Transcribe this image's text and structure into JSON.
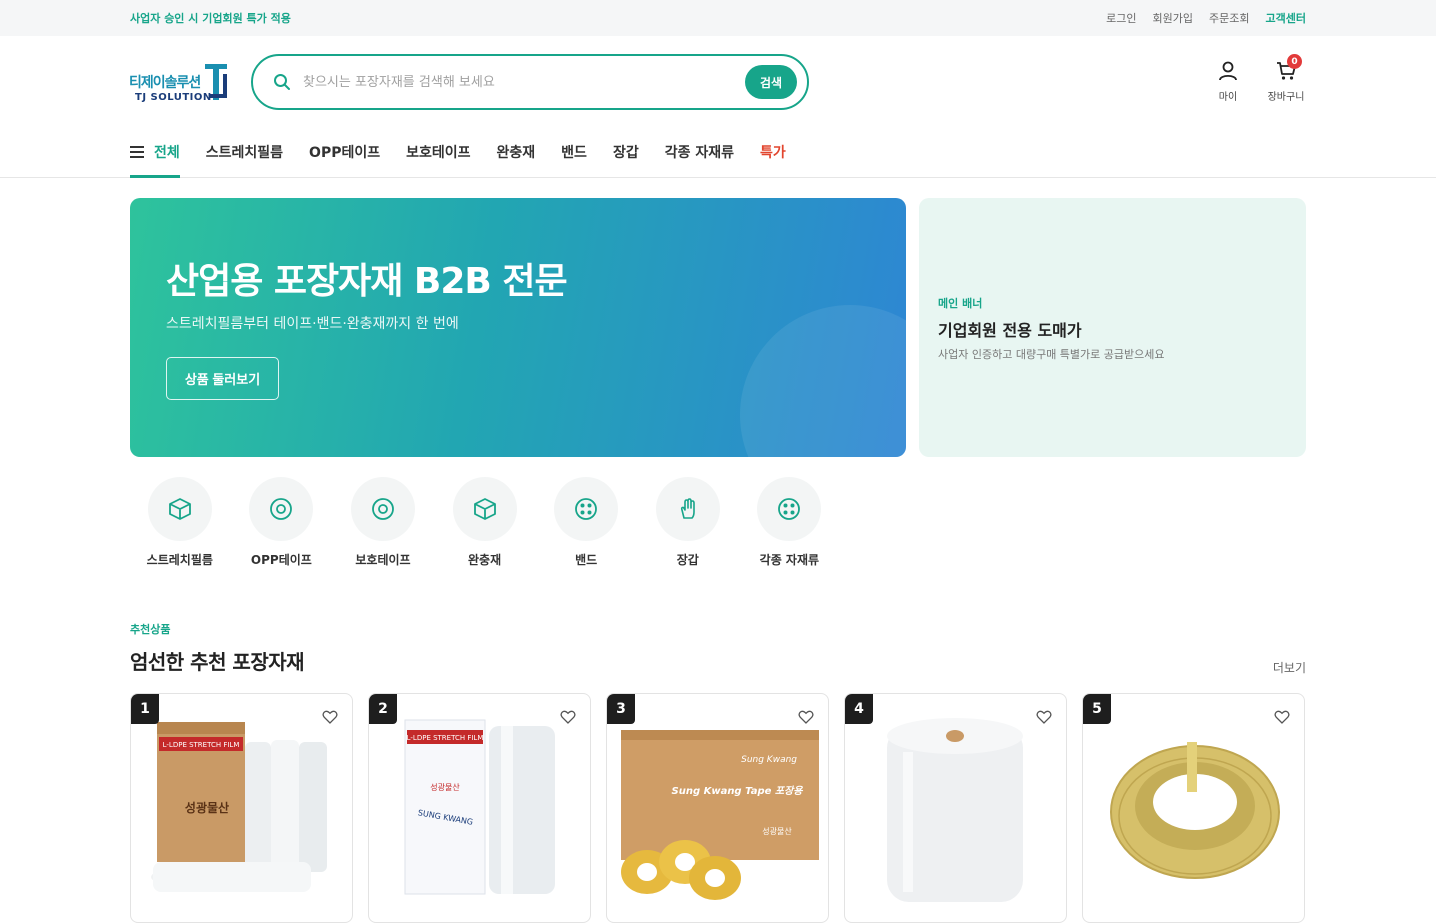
{
  "topbar": {
    "promo": "사업자 승인 시 기업회원 특가 적용",
    "links": [
      "로그인",
      "회원가입",
      "주문조회"
    ],
    "customer_center": "고객센터"
  },
  "logo": {
    "korean": "티제이솔루션",
    "english": "TJ SOLUTION"
  },
  "search": {
    "placeholder": "찾으시는 포장자재를 검색해 보세요",
    "value": "",
    "button": "검색"
  },
  "util": {
    "my_label": "마이",
    "cart_label": "장바구니",
    "cart_count": "0"
  },
  "nav": {
    "all": "전체",
    "items": [
      "스트레치필름",
      "OPP테이프",
      "보호테이프",
      "완충재",
      "밴드",
      "장갑",
      "각종 자재류"
    ],
    "sale": "특가"
  },
  "hero": {
    "title": "산업용 포장자재 B2B 전문",
    "subtitle": "스트레치필름부터 테이프·밴드·완충재까지 한 번에",
    "cta": "상품 둘러보기"
  },
  "side_banner": {
    "tag": "메인 배너",
    "title": "기업회원 전용 도매가",
    "desc": "사업자 인증하고 대량구매 특별가로 공급받으세요"
  },
  "categories": [
    {
      "label": "스트레치필름",
      "icon": "box-icon"
    },
    {
      "label": "OPP테이프",
      "icon": "tape-roll-icon"
    },
    {
      "label": "보호테이프",
      "icon": "tape-roll-icon"
    },
    {
      "label": "완충재",
      "icon": "box-icon"
    },
    {
      "label": "밴드",
      "icon": "grid-dots-icon"
    },
    {
      "label": "장갑",
      "icon": "glove-icon"
    },
    {
      "label": "각종 자재류",
      "icon": "grid-dots-icon"
    }
  ],
  "recommend": {
    "tag": "추천상품",
    "title": "엄선한 추천 포장자재",
    "more": "더보기"
  },
  "products": [
    {
      "rank": "1",
      "image": "stretch-film-box",
      "image_text": {
        "box_label": "L-LDPE STRETCH FILM",
        "brand": "성광물산"
      }
    },
    {
      "rank": "2",
      "image": "stretch-film-pack",
      "image_text": {
        "box_label": "L-LDPE STRETCH FILM",
        "brand": "성광물산",
        "brand_en": "SUNG KWANG"
      }
    },
    {
      "rank": "3",
      "image": "tape-box",
      "image_text": {
        "box_label": "Sung Kwang Tape 포장용",
        "brand": "성광물산",
        "brand_en": "Sung Kwang"
      }
    },
    {
      "rank": "4",
      "image": "bubble-wrap-roll"
    },
    {
      "rank": "5",
      "image": "pp-band-coil"
    }
  ],
  "colors": {
    "accent": "#17a58a",
    "sale": "#e2452e",
    "badge": "#e23a3a"
  }
}
